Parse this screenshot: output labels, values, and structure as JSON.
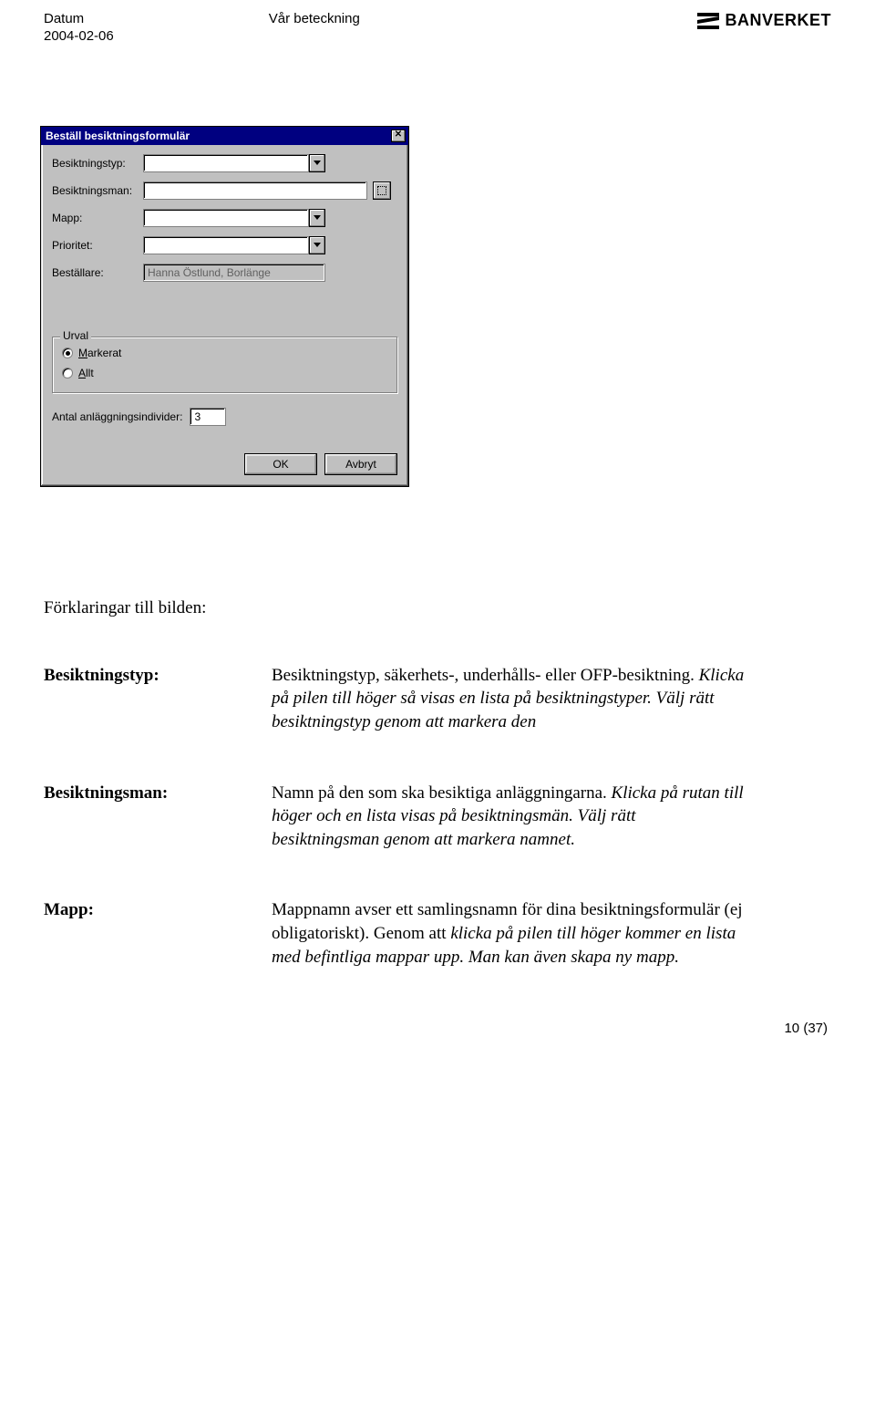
{
  "header": {
    "datum_label": "Datum",
    "datum_value": "2004-02-06",
    "beteckning_label": "Vår beteckning",
    "brand": "BANVERKET"
  },
  "dialog": {
    "title": "Beställ besiktningsformulär",
    "fields": {
      "besiktningstyp_label": "Besiktningstyp:",
      "besiktningsman_label": "Besiktningsman:",
      "mapp_label": "Mapp:",
      "prioritet_label": "Prioritet:",
      "bestallare_label": "Beställare:",
      "bestallare_value": "Hanna Östlund, Borlänge"
    },
    "urval": {
      "legend": "Urval",
      "opt_markerat": "Markerat",
      "opt_allt": "Allt",
      "selected": "markerat"
    },
    "count_label": "Antal anläggningsindivider:",
    "count_value": "3",
    "ok_label": "OK",
    "cancel_label": "Avbryt"
  },
  "explain": {
    "heading": "Förklaringar till bilden:",
    "besiktningstyp": {
      "term": "Besiktningstyp:",
      "p1": "Besiktningstyp, säkerhets-, underhålls- eller OFP-besiktning. ",
      "p2_em": "Klicka på pilen till höger så visas en lista på besiktningstyper. Välj rätt besiktningstyp genom att markera den"
    },
    "besiktningsman": {
      "term": "Besiktningsman:",
      "p1": "Namn på den som ska besiktiga anläggningarna. ",
      "p2_em": "Klicka på rutan till höger och en lista visas på besiktningsmän. Välj rätt besiktningsman genom att markera namnet."
    },
    "mapp": {
      "term": "Mapp:",
      "p1": "Mappnamn avser ett samlingsnamn för dina besiktningsformulär (ej obligatoriskt). Genom att ",
      "p2_em": "klicka på pilen till höger kommer en lista med befintliga mappar upp. Man kan även skapa ny mapp."
    }
  },
  "page_num": "10 (37)"
}
